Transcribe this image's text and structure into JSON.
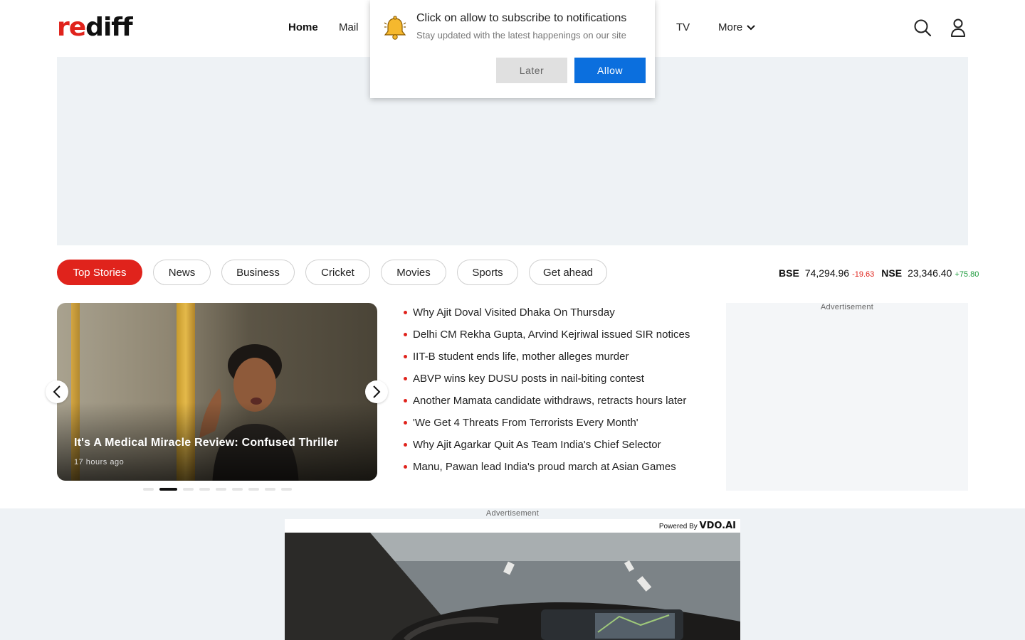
{
  "header": {
    "logo_prefix": "re",
    "logo_suffix": "diff",
    "nav": [
      "Home",
      "Mail",
      "TV"
    ],
    "more_label": "More"
  },
  "notification": {
    "title": "Click on allow to subscribe to notifications",
    "subtitle": "Stay updated with the latest happenings on our site",
    "later_label": "Later",
    "allow_label": "Allow"
  },
  "categories": [
    "Top Stories",
    "News",
    "Business",
    "Cricket",
    "Movies",
    "Sports",
    "Get ahead"
  ],
  "market": {
    "bse_label": "BSE",
    "bse_value": "74,294.96",
    "bse_change": "-19.63",
    "nse_label": "NSE",
    "nse_value": "23,346.40",
    "nse_change": "+75.80"
  },
  "carousel": {
    "headline": "It's A Medical Miracle Review: Confused Thriller",
    "time": "17 hours ago",
    "slide_count": 9,
    "active_index": 1
  },
  "headlines": [
    "Why Ajit Doval Visited Dhaka On Thursday",
    "Delhi CM Rekha Gupta, Arvind Kejriwal issued SIR notices",
    "IIT-B student ends life, mother alleges murder",
    "ABVP wins key DUSU posts in nail-biting contest",
    "Another Mamata candidate withdraws, retracts hours later",
    "'We Get 4 Threats From Terrorists Every Month'",
    "Why Ajit Agarkar Quit As Team India's Chief Selector",
    "Manu, Pawan lead India's proud march at Asian Games"
  ],
  "ads": {
    "side_label": "Advertisement",
    "bottom_label": "Advertisement",
    "powered_by": "Powered By",
    "vdo_brand": "VDO.AI"
  },
  "colors": {
    "brand_red": "#e0231c",
    "allow_blue": "#0b6fde",
    "positive": "#1a9a3a"
  }
}
